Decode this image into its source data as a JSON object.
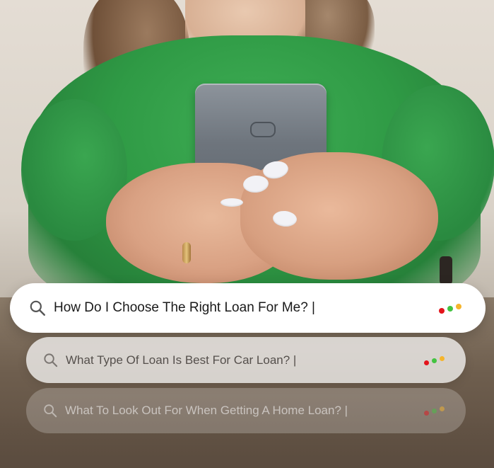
{
  "searches": [
    {
      "query": "How Do I Choose The Right Loan For Me? |",
      "icon": "search-icon",
      "dots": [
        "#e3141b",
        "#43c341",
        "#f5b52c"
      ]
    },
    {
      "query": "What Type Of Loan Is Best For Car Loan? |",
      "icon": "search-icon",
      "dots": [
        "#e3141b",
        "#43c341",
        "#f5b52c"
      ]
    },
    {
      "query": "What To Look Out For When Getting A Home Loan? |",
      "icon": "search-icon",
      "dots": [
        "#e3141b",
        "#43c341",
        "#f5b52c"
      ]
    }
  ],
  "photo": {
    "subject": "woman-holding-smartphone",
    "shirt_color": "#2f9a45",
    "phone_color": "#6e757d"
  }
}
